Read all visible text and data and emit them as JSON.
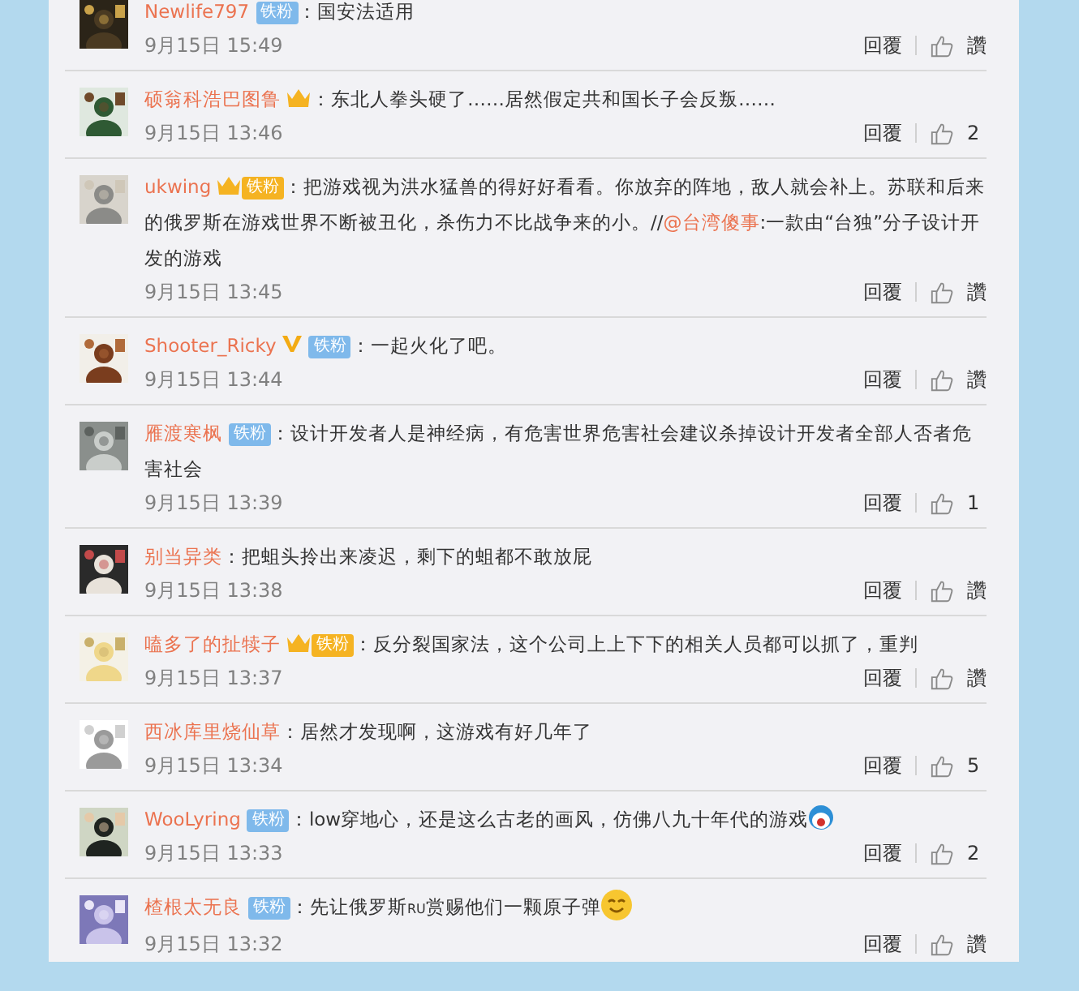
{
  "comments": [
    {
      "user": "Newlife797",
      "badges": [
        {
          "kind": "fan",
          "text": "铁粉"
        }
      ],
      "segments": [
        {
          "kind": "plain",
          "text": "：国安法适用"
        }
      ],
      "time": "9月15日 15:49",
      "reply": "回覆",
      "like": "讚"
    },
    {
      "user": "硕翁科浩巴图鲁",
      "badges": [
        {
          "kind": "crown"
        }
      ],
      "segments": [
        {
          "kind": "plain",
          "text": "：东北人拳头硬了……居然假定共和国长子会反叛……"
        }
      ],
      "time": "9月15日 13:46",
      "reply": "回覆",
      "like": "2"
    },
    {
      "user": "ukwing",
      "badges": [
        {
          "kind": "crown_fan",
          "text": "铁粉"
        }
      ],
      "segments": [
        {
          "kind": "plain",
          "text": "：把游戏视为洪水猛兽的得好好看看。你放弃的阵地，敌人就会补上。苏联和后来的俄罗斯在游戏世界不断被丑化，杀伤力不比战争来的小。//"
        },
        {
          "kind": "link",
          "text": "@台湾傻事"
        },
        {
          "kind": "plain",
          "text": ":一款由“台独”分子设计开发的游戏"
        }
      ],
      "time": "9月15日 13:45",
      "reply": "回覆",
      "like": "讚"
    },
    {
      "user": "Shooter_Ricky",
      "badges": [
        {
          "kind": "verified"
        },
        {
          "kind": "fan",
          "text": "铁粉"
        }
      ],
      "segments": [
        {
          "kind": "plain",
          "text": "：一起火化了吧。"
        }
      ],
      "time": "9月15日 13:44",
      "reply": "回覆",
      "like": "讚"
    },
    {
      "user": "雁渡寒枫",
      "badges": [
        {
          "kind": "fan",
          "text": "铁粉"
        }
      ],
      "segments": [
        {
          "kind": "plain",
          "text": "：设计开发者人是神经病，有危害世界危害社会建议杀掉设计开发者全部人否者危害社会"
        }
      ],
      "time": "9月15日 13:39",
      "reply": "回覆",
      "like": "1"
    },
    {
      "user": "别当异类",
      "segments": [
        {
          "kind": "plain",
          "text": "：把蛆头拎出来凌迟，剩下的蛆都不敢放屁"
        }
      ],
      "time": "9月15日 13:38",
      "reply": "回覆",
      "like": "讚"
    },
    {
      "user": "嗑多了的扯犊子",
      "badges": [
        {
          "kind": "crown_fan",
          "text": "铁粉"
        }
      ],
      "segments": [
        {
          "kind": "plain",
          "text": "：反分裂国家法，这个公司上上下下的相关人员都可以抓了，重判"
        }
      ],
      "time": "9月15日 13:37",
      "reply": "回覆",
      "like": "讚"
    },
    {
      "user": "西冰库里烧仙草",
      "segments": [
        {
          "kind": "plain",
          "text": "：居然才发现啊，这游戏有好几年了"
        }
      ],
      "time": "9月15日 13:34",
      "reply": "回覆",
      "like": "5"
    },
    {
      "user": "WooLyring",
      "badges": [
        {
          "kind": "fan",
          "text": "铁粉"
        }
      ],
      "segments": [
        {
          "kind": "plain",
          "text": "：low穿地心，还是这么古老的画风，仿佛八九十年代的游戏"
        },
        {
          "kind": "emoji_face"
        }
      ],
      "time": "9月15日 13:33",
      "reply": "回覆",
      "like": "2"
    },
    {
      "user": "楂根太无良",
      "badges": [
        {
          "kind": "fan",
          "text": "铁粉"
        }
      ],
      "segments": [
        {
          "kind": "plain",
          "text": "：先让俄罗斯"
        },
        {
          "kind": "small",
          "text": "RU"
        },
        {
          "kind": "plain",
          "text": "赏赐他们一颗原子弹"
        },
        {
          "kind": "emoji_smile"
        }
      ],
      "time": "9月15日 13:32",
      "reply": "回覆",
      "like": "讚"
    }
  ]
}
